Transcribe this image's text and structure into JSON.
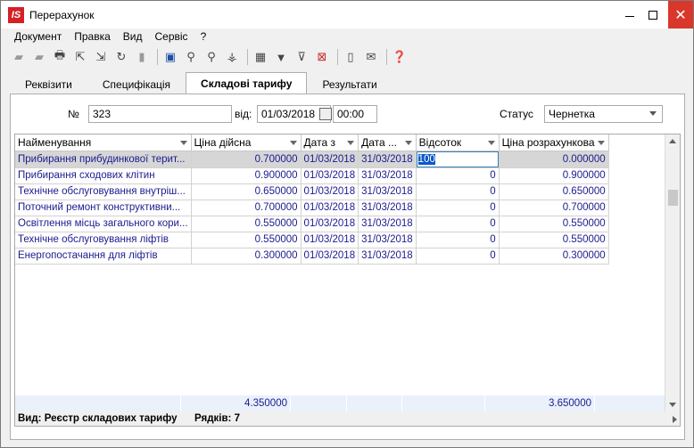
{
  "window": {
    "title": "Перерахунок",
    "app_icon_text": "IS"
  },
  "menu": [
    "Документ",
    "Правка",
    "Вид",
    "Сервіс",
    "?"
  ],
  "tabs": [
    {
      "label": "Реквізити",
      "active": false
    },
    {
      "label": "Специфікація",
      "active": false
    },
    {
      "label": "Складові тарифу",
      "active": true
    },
    {
      "label": "Результати",
      "active": false
    }
  ],
  "form": {
    "number_label": "№",
    "number_value": "323",
    "date_label": "від:",
    "date_value": "01/03/2018",
    "time_value": "00:00",
    "status_label": "Статус",
    "status_value": "Чернетка"
  },
  "grid": {
    "columns": [
      "Найменування",
      "Ціна дійсна",
      "Дата з",
      "Дата ...",
      "Відсоток",
      "Ціна розрахункова"
    ],
    "rows": [
      {
        "name": "Прибирання прибудинкової терит...",
        "price": "0.700000",
        "date_from": "01/03/2018",
        "date_to": "31/03/2018",
        "percent": "100",
        "calc_price": "0.000000"
      },
      {
        "name": "Прибирання сходових клітин",
        "price": "0.900000",
        "date_from": "01/03/2018",
        "date_to": "31/03/2018",
        "percent": "0",
        "calc_price": "0.900000"
      },
      {
        "name": "Технічне обслуговування внутріш...",
        "price": "0.650000",
        "date_from": "01/03/2018",
        "date_to": "31/03/2018",
        "percent": "0",
        "calc_price": "0.650000"
      },
      {
        "name": "Поточний ремонт конструктивни...",
        "price": "0.700000",
        "date_from": "01/03/2018",
        "date_to": "31/03/2018",
        "percent": "0",
        "calc_price": "0.700000"
      },
      {
        "name": "Освітлення місць загального кори...",
        "price": "0.550000",
        "date_from": "01/03/2018",
        "date_to": "31/03/2018",
        "percent": "0",
        "calc_price": "0.550000"
      },
      {
        "name": "Технічне обслуговування ліфтів",
        "price": "0.550000",
        "date_from": "01/03/2018",
        "date_to": "31/03/2018",
        "percent": "0",
        "calc_price": "0.550000"
      },
      {
        "name": "Енергопостачання для ліфтів",
        "price": "0.300000",
        "date_from": "01/03/2018",
        "date_to": "31/03/2018",
        "percent": "0",
        "calc_price": "0.300000"
      }
    ],
    "totals": {
      "price": "4.350000",
      "calc_price": "3.650000"
    },
    "view_label": "Вид: Реєстр складових тарифу",
    "rows_label": "Рядків: 7"
  }
}
